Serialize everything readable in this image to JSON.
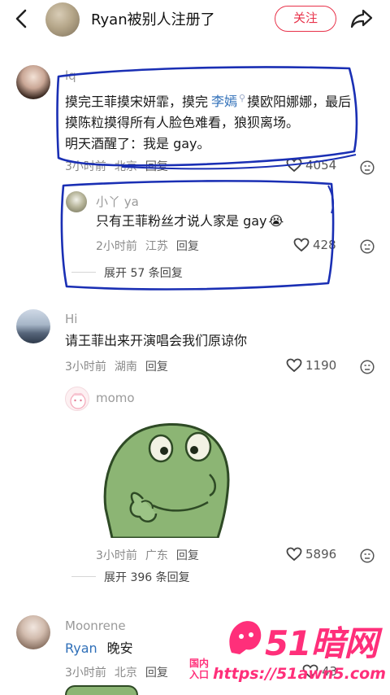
{
  "header": {
    "title": "Ryan被别人注册了",
    "follow_label": "关注"
  },
  "comments": [
    {
      "user": "lq",
      "lines": [
        "摸完王菲摸宋妍霏，摸完",
        "李嫣",
        "摸欧阳娜娜，最后",
        "摸陈粒摸得所有人脸色难看，狼狈离场。",
        "明天酒醒了：我是 gay。"
      ],
      "time": "3小时前",
      "location": "北京",
      "reply_label": "回复",
      "likes": "4054",
      "replies": [
        {
          "user": "小丫 ya",
          "text": "只有王菲粉丝才说人家是 gay",
          "emoji": "😭",
          "time": "2小时前",
          "location": "江苏",
          "reply_label": "回复",
          "likes": "428"
        }
      ],
      "expand_label": "展开 57 条回复"
    },
    {
      "user": "Hi",
      "text": "请王菲出来开演唱会我们原谅你",
      "time": "3小时前",
      "location": "湖南",
      "reply_label": "回复",
      "likes": "1190",
      "replies": [
        {
          "user": "momo",
          "sticker": "frog-thinking-sticker",
          "time": "3小时前",
          "location": "广东",
          "reply_label": "回复",
          "likes": "5896"
        }
      ],
      "expand_label": "展开 396 条回复"
    },
    {
      "user": "Moonrene",
      "mention": "Ryan",
      "text": "晚安",
      "time": "3小时前",
      "location": "北京",
      "reply_label": "回复",
      "likes": "43"
    }
  ],
  "watermark": {
    "brand": "51暗网",
    "badge_line1": "国内",
    "badge_line2": "入口",
    "url": "https://51awn5.com"
  },
  "colors": {
    "accent": "#e8324a",
    "mention": "#2f6fb8",
    "annotation": "#1a2fb4",
    "watermark": "#ff2f7a"
  }
}
